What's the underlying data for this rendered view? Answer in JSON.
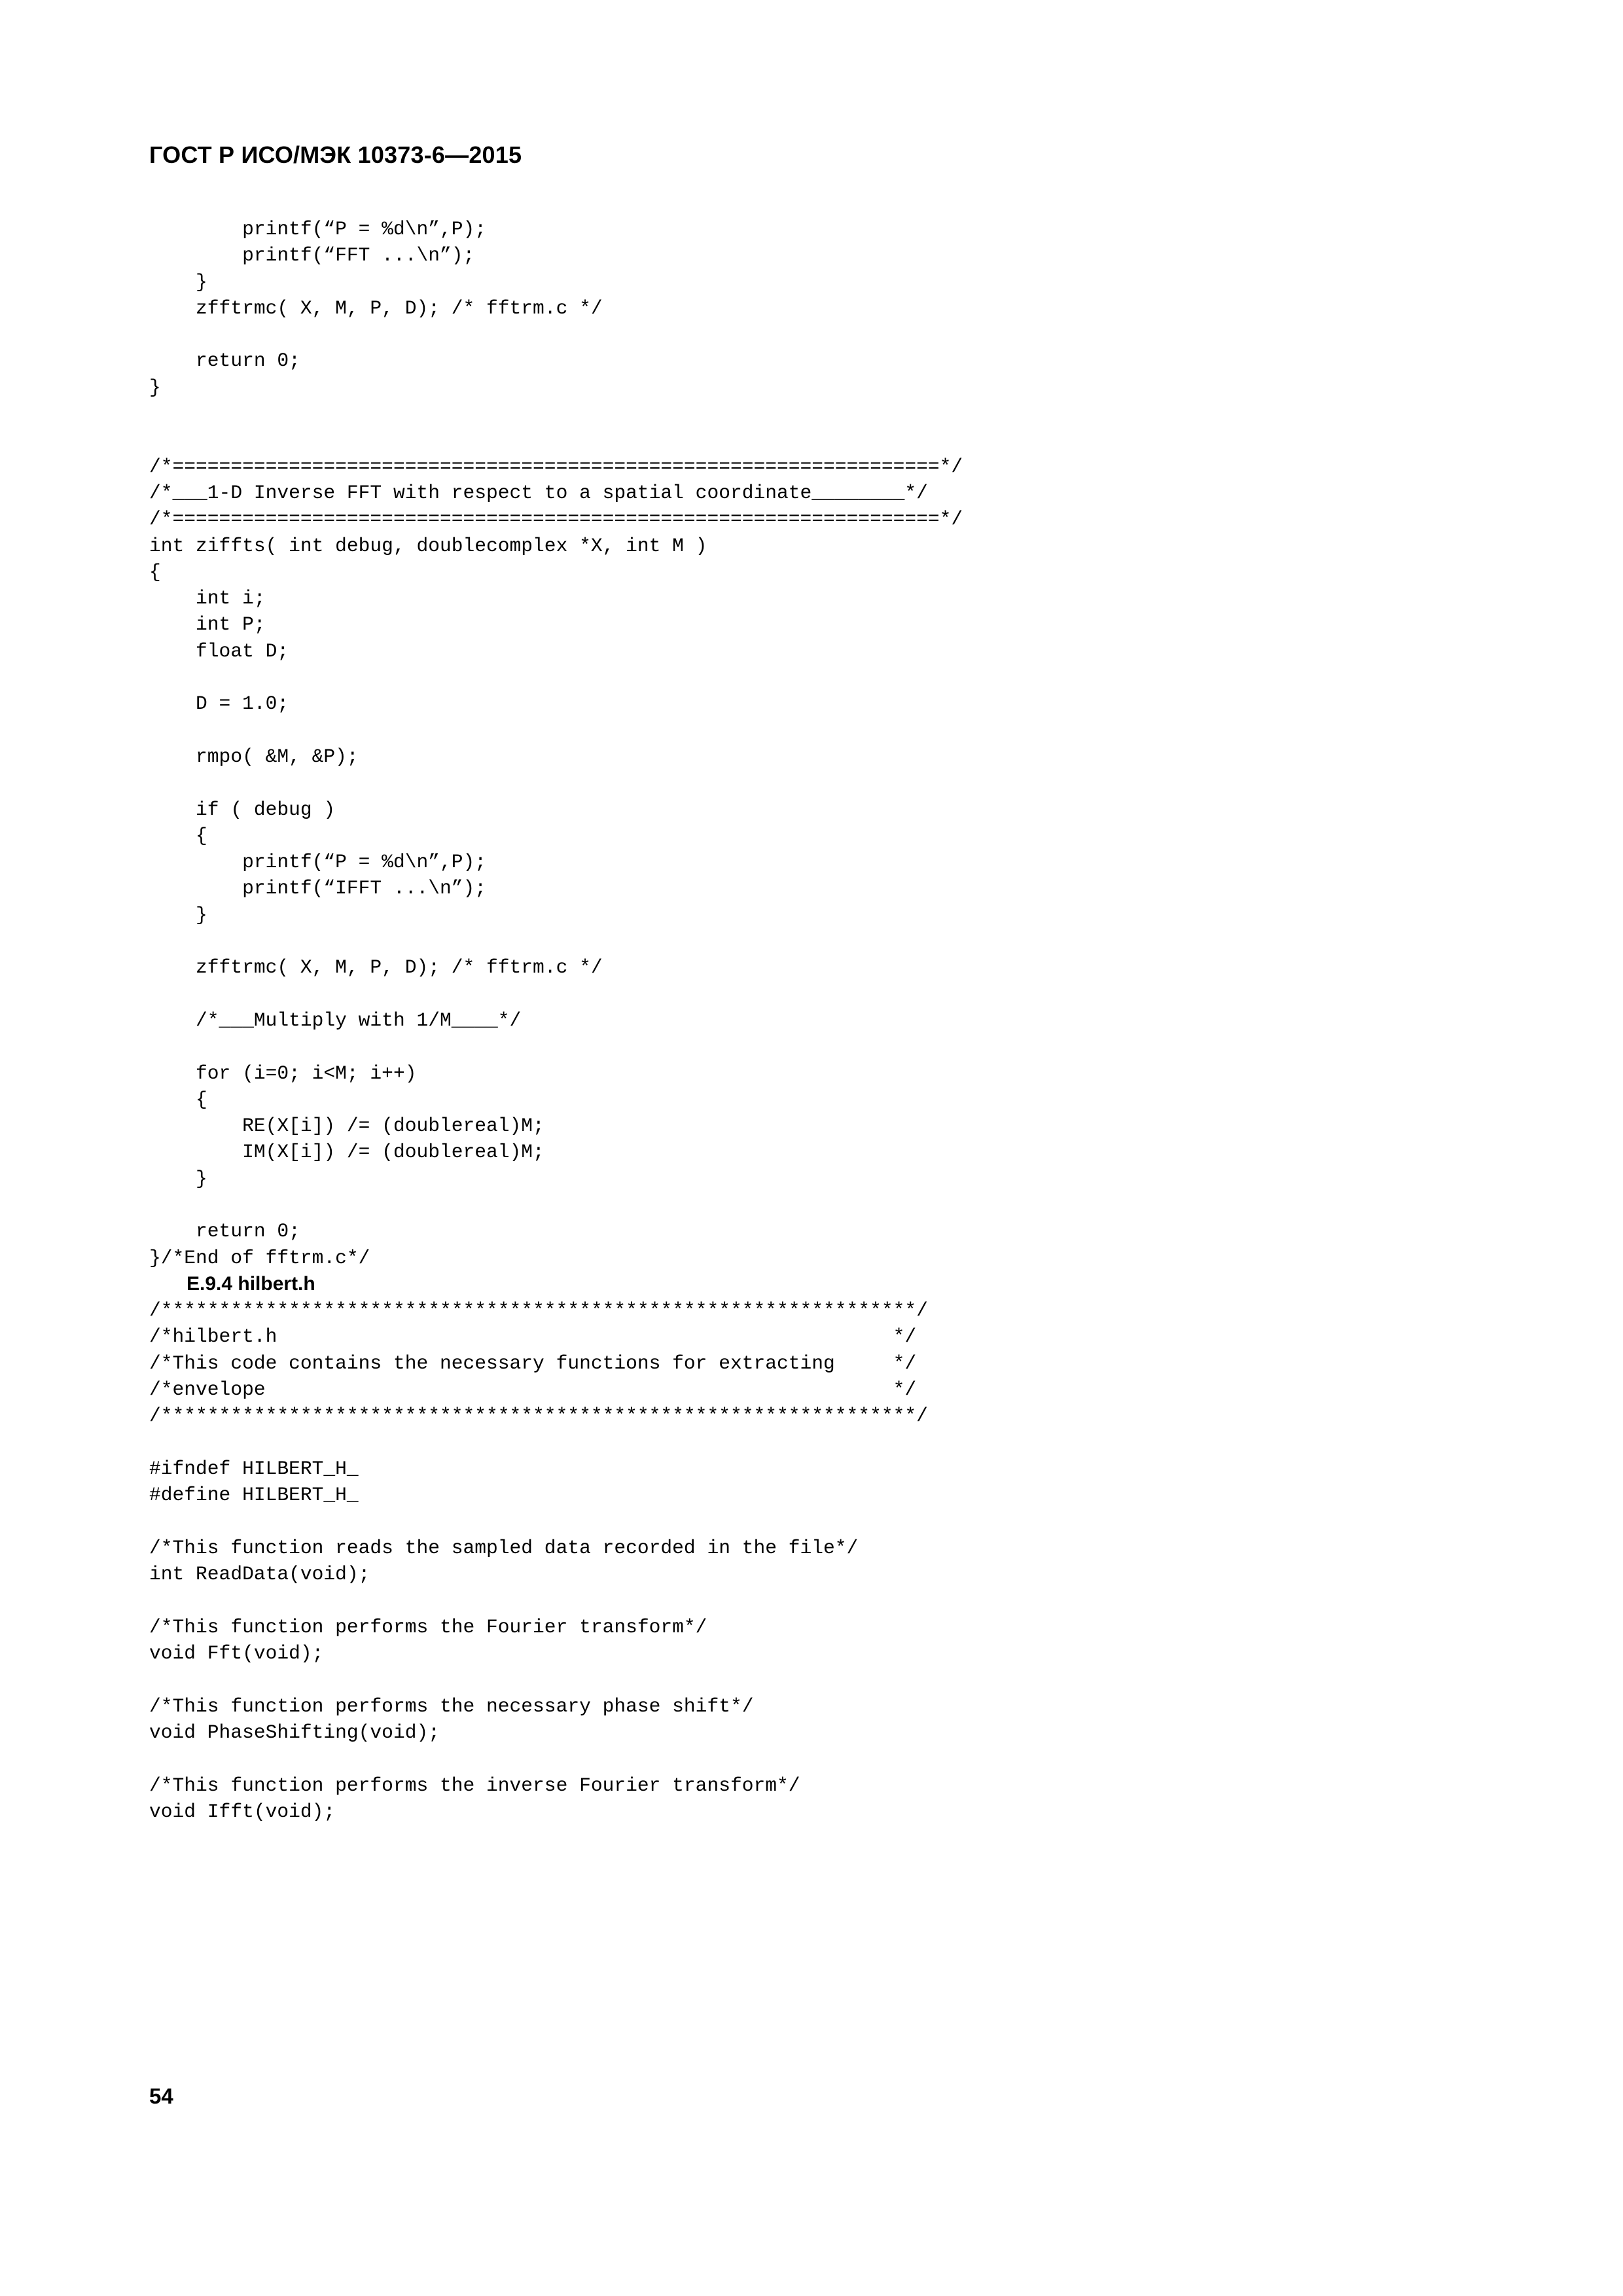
{
  "document": {
    "header": "ГОСТ Р ИСО/МЭК 10373-6—2015",
    "page_number": "54",
    "page_background": "#ffffff",
    "text_color": "#000000"
  },
  "headings": {
    "e94_hilbert_h": "E.9.4 hilbert.h"
  },
  "code": {
    "lines": [
      "        printf(“P = %d\\n”,P);",
      "        printf(“FFT ...\\n”);",
      "    }",
      "    zfftrmc( X, M, P, D); /* fftrm.c */",
      "",
      "    return 0;",
      "}",
      "",
      "",
      "/*==================================================================*/",
      "/*___1-D Inverse FFT with respect to a spatial coordinate________*/",
      "/*==================================================================*/",
      "int ziffts( int debug, doublecomplex *X, int M )",
      "{",
      "    int i;",
      "    int P;",
      "    float D;",
      "",
      "    D = 1.0;",
      "",
      "    rmpo( &M, &P);",
      "",
      "    if ( debug )",
      "    {",
      "        printf(“P = %d\\n”,P);",
      "        printf(“IFFT ...\\n”);",
      "    }",
      "",
      "    zfftrmc( X, M, P, D); /* fftrm.c */",
      "",
      "    /*___Multiply with 1/M____*/",
      "",
      "    for (i=0; i<M; i++)",
      "    {",
      "        RE(X[i]) /= (doublereal)M;",
      "        IM(X[i]) /= (doublereal)M;",
      "    }",
      "",
      "    return 0;",
      "}/*End of fftrm.c*/"
    ],
    "lines_after_heading": [
      "/*****************************************************************/",
      "/*hilbert.h                                                     */",
      "/*This code contains the necessary functions for extracting     */",
      "/*envelope                                                      */",
      "/*****************************************************************/",
      "",
      "#ifndef HILBERT_H_",
      "#define HILBERT_H_",
      "",
      "/*This function reads the sampled data recorded in the file*/",
      "int ReadData(void);",
      "",
      "/*This function performs the Fourier transform*/",
      "void Fft(void);",
      "",
      "/*This function performs the necessary phase shift*/",
      "void PhaseShifting(void);",
      "",
      "/*This function performs the inverse Fourier transform*/",
      "void Ifft(void);"
    ]
  }
}
